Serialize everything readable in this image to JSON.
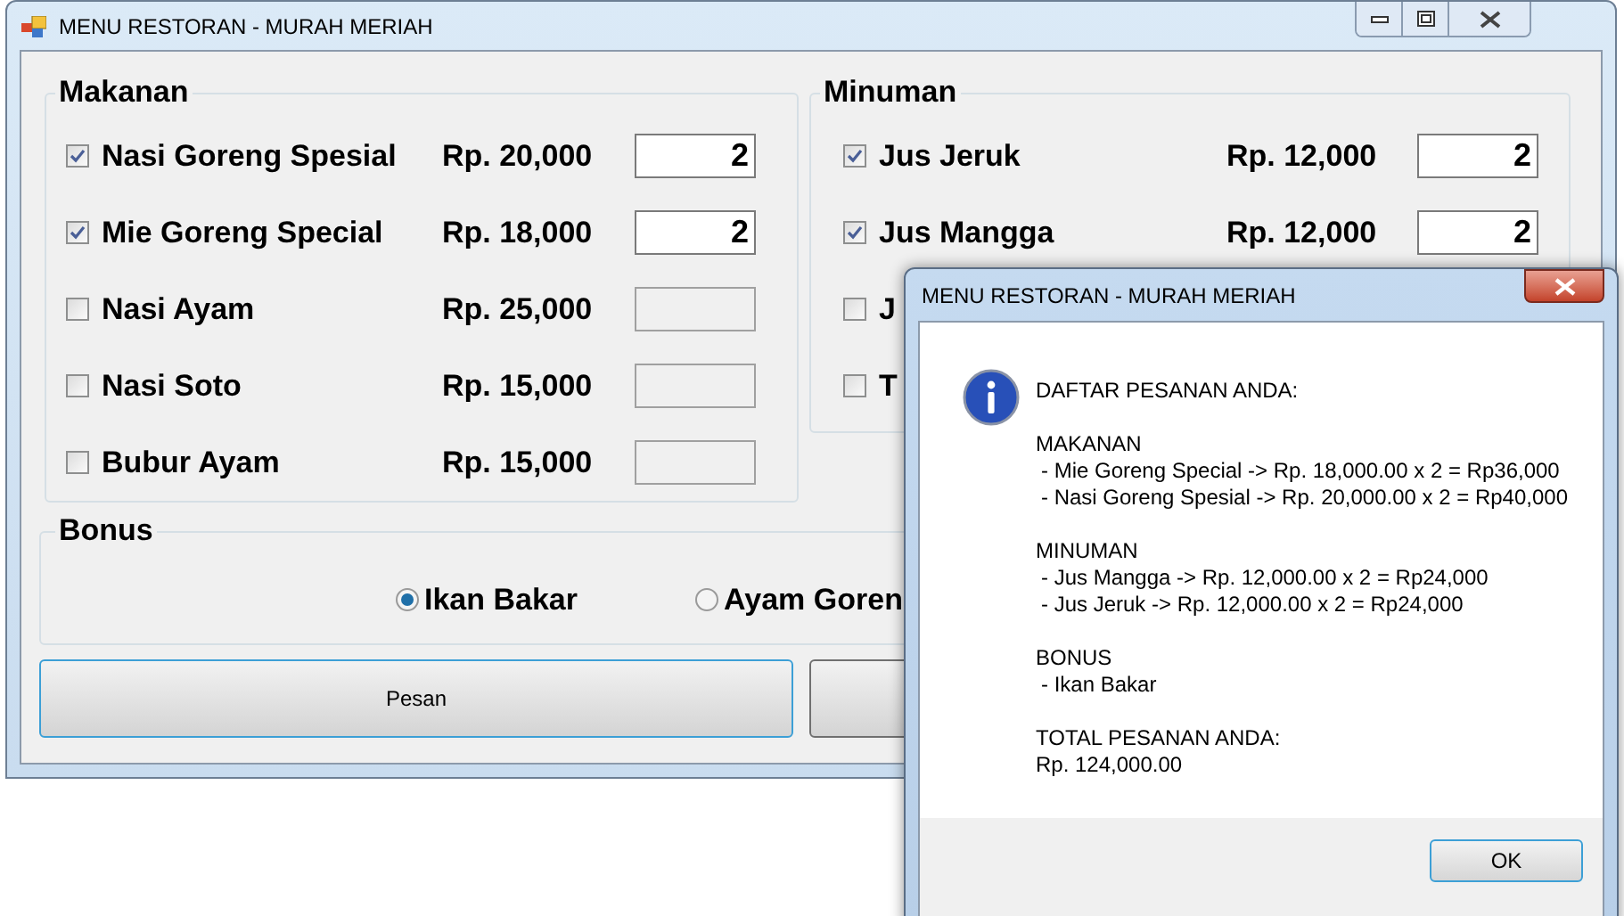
{
  "window": {
    "title": "MENU RESTORAN - MURAH MERIAH"
  },
  "makanan": {
    "title": "Makanan",
    "items": [
      {
        "name": "Nasi Goreng Spesial",
        "price": "Rp. 20,000",
        "checked": true,
        "qty": "2"
      },
      {
        "name": "Mie Goreng Special",
        "price": "Rp. 18,000",
        "checked": true,
        "qty": "2"
      },
      {
        "name": "Nasi Ayam",
        "price": "Rp. 25,000",
        "checked": false
      },
      {
        "name": "Nasi Soto",
        "price": "Rp. 15,000",
        "checked": false
      },
      {
        "name": "Bubur Ayam",
        "price": "Rp. 15,000",
        "checked": false
      }
    ]
  },
  "minuman": {
    "title": "Minuman",
    "items": [
      {
        "name": "Jus Jeruk",
        "price": "Rp. 12,000",
        "checked": true,
        "qty": "2"
      },
      {
        "name": "Jus Mangga",
        "price": "Rp. 12,000",
        "checked": true,
        "qty": "2"
      },
      {
        "name": "J",
        "checked": false
      },
      {
        "name": "T",
        "checked": false
      }
    ]
  },
  "bonus": {
    "title": "Bonus",
    "options": [
      {
        "label": "Ikan Bakar",
        "selected": true
      },
      {
        "label": "Ayam Goren",
        "selected": false
      }
    ]
  },
  "buttons": [
    {
      "label": "Pesan",
      "focused": true
    },
    {
      "focused": false
    }
  ],
  "dialog": {
    "title": "MENU RESTORAN - MURAH MERIAH",
    "sections": [
      {
        "heading": "DAFTAR PESANAN ANDA:"
      },
      {
        "heading": "MAKANAN",
        "items": [
          "- Mie Goreng Special -> Rp. 18,000.00 x 2 = Rp36,000",
          "- Nasi Goreng Spesial -> Rp. 20,000.00 x 2 = Rp40,000"
        ]
      },
      {
        "heading": "MINUMAN",
        "items": [
          "- Jus Mangga -> Rp. 12,000.00 x 2 = Rp24,000",
          "- Jus Jeruk -> Rp. 12,000.00 x 2 = Rp24,000"
        ]
      },
      {
        "heading": "BONUS",
        "items": [
          "- Ikan Bakar"
        ]
      },
      {
        "heading": "TOTAL PESANAN ANDA:",
        "value": "Rp. 124,000.00"
      }
    ],
    "button": "OK"
  }
}
